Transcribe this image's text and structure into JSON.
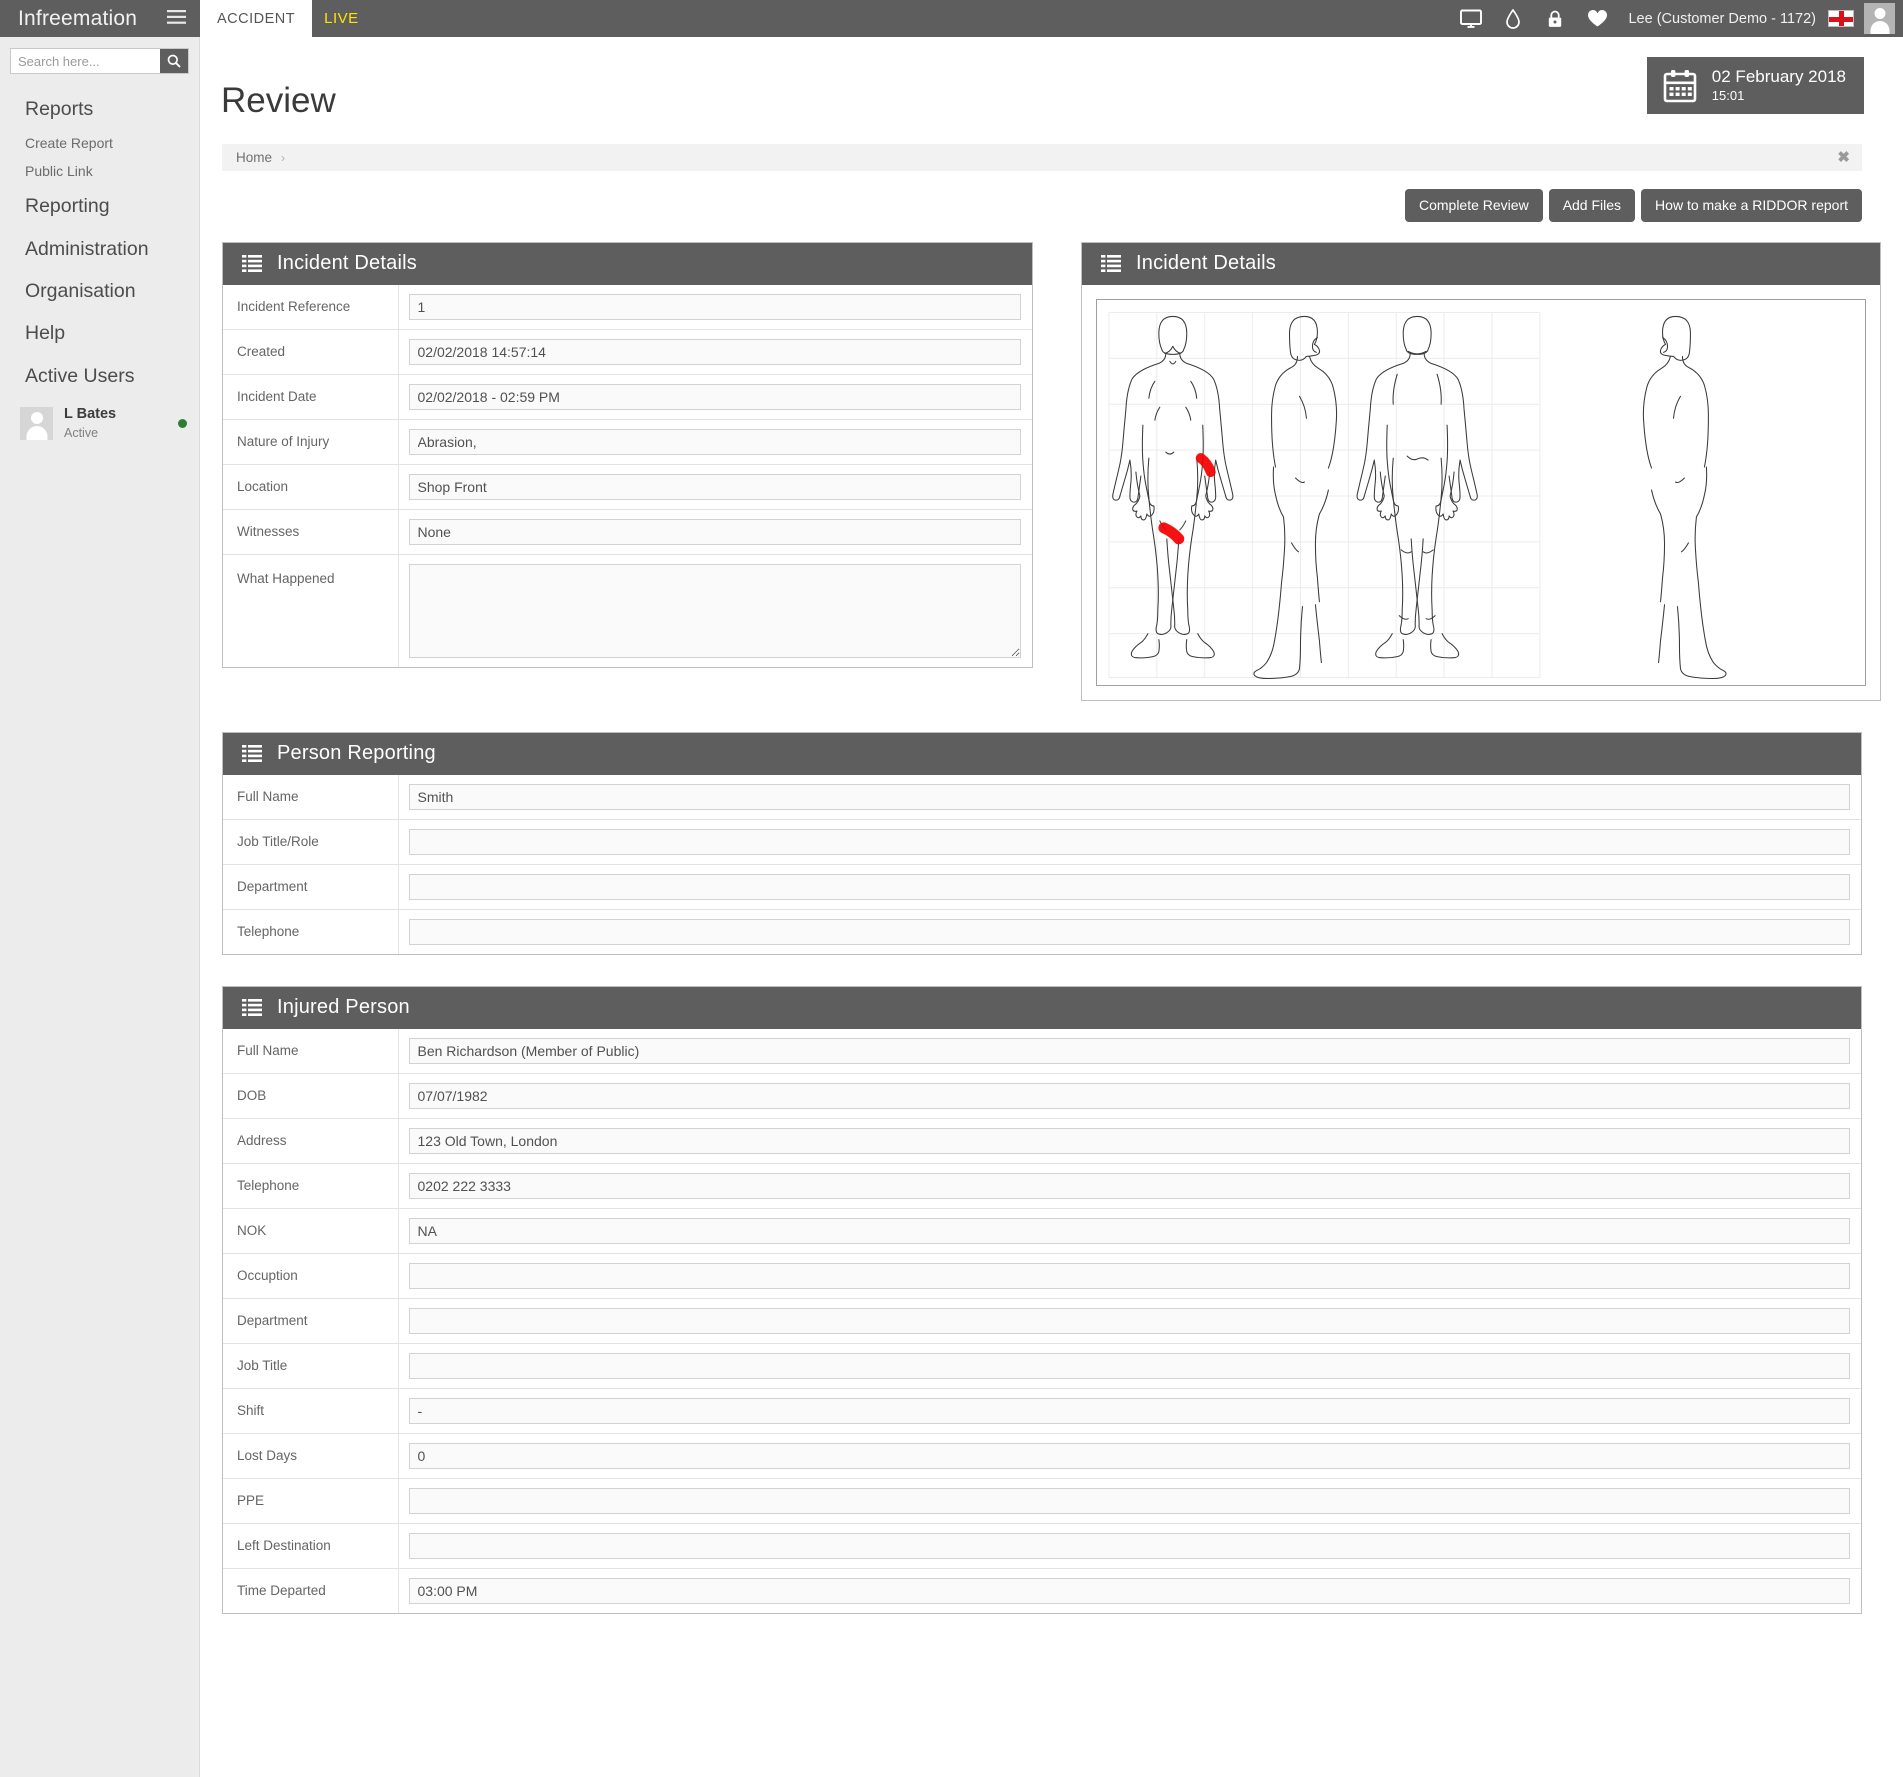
{
  "topbar": {
    "brand": "Infreemation",
    "menu_icon": "hamburger-icon",
    "tabs": [
      {
        "label": "ACCIDENT",
        "active": true
      },
      {
        "label": "LIVE",
        "active": false
      }
    ],
    "icons": [
      "monitor-icon",
      "water-drop-icon",
      "lock-icon",
      "heart-icon"
    ],
    "user_label": "Lee (Customer Demo - 1172)",
    "flag": "england-flag-icon",
    "avatar": "user-avatar"
  },
  "sidebar": {
    "search_placeholder": "Search here...",
    "search_value": "",
    "search_icon": "search-icon",
    "items": [
      {
        "label": "Reports",
        "type": "main"
      },
      {
        "label": "Create Report",
        "type": "sub"
      },
      {
        "label": "Public Link",
        "type": "sub"
      },
      {
        "label": "Reporting",
        "type": "main"
      },
      {
        "label": "Administration",
        "type": "main"
      },
      {
        "label": "Organisation",
        "type": "main"
      },
      {
        "label": "Help",
        "type": "main"
      },
      {
        "label": "Active Users",
        "type": "main"
      }
    ],
    "active_user": {
      "name": "L Bates",
      "status": "Active",
      "status_color": "#2f7d32"
    }
  },
  "page": {
    "title": "Review",
    "date_widget": {
      "icon": "calendar-icon",
      "date": "02 February 2018",
      "time": "15:01"
    },
    "breadcrumb": {
      "items": [
        "Home"
      ],
      "separator": "›",
      "close_icon": "close-icon"
    },
    "actions": [
      {
        "label": "Complete Review"
      },
      {
        "label": "Add Files"
      },
      {
        "label": "How to make a RIDDOR report"
      }
    ]
  },
  "panels": {
    "incident_details": {
      "title": "Incident Details",
      "icon": "list-icon",
      "fields": [
        {
          "label": "Incident Reference",
          "value": "1",
          "type": "input"
        },
        {
          "label": "Created",
          "value": "02/02/2018 14:57:14",
          "type": "input"
        },
        {
          "label": "Incident Date",
          "value": "02/02/2018 - 02:59 PM",
          "type": "input"
        },
        {
          "label": "Nature of Injury",
          "value": "Abrasion,",
          "type": "input"
        },
        {
          "label": "Location",
          "value": "Shop Front",
          "type": "input"
        },
        {
          "label": "Witnesses",
          "value": "None",
          "type": "input"
        },
        {
          "label": "What Happened",
          "value": "",
          "type": "textarea"
        }
      ]
    },
    "body_map": {
      "title": "Incident Details",
      "icon": "list-icon",
      "figures": [
        "front",
        "left-side",
        "back",
        "right-side"
      ],
      "injury_marks": [
        {
          "area": "left-forearm",
          "color": "#f40000"
        },
        {
          "area": "left-thigh",
          "color": "#f40000"
        }
      ]
    },
    "person_reporting": {
      "title": "Person Reporting",
      "icon": "list-icon",
      "fields": [
        {
          "label": "Full Name",
          "value": "Smith",
          "type": "input"
        },
        {
          "label": "Job Title/Role",
          "value": "",
          "type": "input"
        },
        {
          "label": "Department",
          "value": "",
          "type": "input"
        },
        {
          "label": "Telephone",
          "value": "",
          "type": "input"
        }
      ]
    },
    "injured_person": {
      "title": "Injured Person",
      "icon": "list-icon",
      "fields": [
        {
          "label": "Full Name",
          "value": "Ben Richardson (Member of Public)",
          "type": "input"
        },
        {
          "label": "DOB",
          "value": "07/07/1982",
          "type": "input"
        },
        {
          "label": "Address",
          "value": "123 Old Town, London",
          "type": "input"
        },
        {
          "label": "Telephone",
          "value": "0202 222 3333",
          "type": "input"
        },
        {
          "label": "NOK",
          "value": "NA",
          "type": "input"
        },
        {
          "label": "Occuption",
          "value": "",
          "type": "input"
        },
        {
          "label": "Department",
          "value": "",
          "type": "input"
        },
        {
          "label": "Job Title",
          "value": "",
          "type": "input"
        },
        {
          "label": "Shift",
          "value": "-",
          "type": "input"
        },
        {
          "label": "Lost Days",
          "value": "0",
          "type": "input"
        },
        {
          "label": "PPE",
          "value": "",
          "type": "input"
        },
        {
          "label": "Left Destination",
          "value": "",
          "type": "input"
        },
        {
          "label": "Time Departed",
          "value": "03:00 PM",
          "type": "input"
        }
      ]
    }
  },
  "colors": {
    "header_gray": "#5e5e5e",
    "sidebar_bg": "#ececec",
    "accent_yellow": "#ffe400",
    "injury_red": "#f40000"
  }
}
